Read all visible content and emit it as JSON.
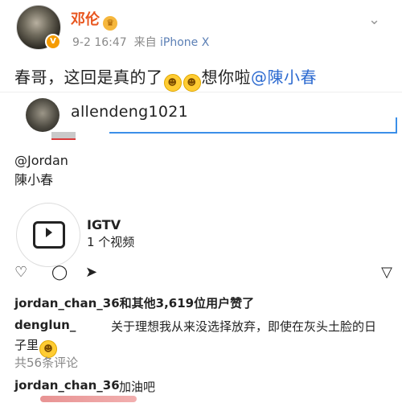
{
  "weibo": {
    "username": "邓伦",
    "date": "9-2 16:47",
    "source_prefix": "来自",
    "source_device": "iPhone X",
    "post_text_1": "春哥，这回是真的了",
    "emoji_1": "😜",
    "emoji_2": "😜",
    "post_text_2": "想你啦",
    "mention": "@陳小春"
  },
  "instagram": {
    "handle": "allendeng1021",
    "tag_line": "@Jordan",
    "tag_name": "陳小春",
    "igtv_title": "IGTV",
    "igtv_sub": "1 个视频",
    "likes_text": "jordan_chan_36和其他3,619位用户赞了",
    "caption_user": "denglun_",
    "caption_line1": "关于理想我从来没选择放弃，即使在灰头土脸的日",
    "caption_line2": "子里",
    "caption_emoji": "😜",
    "comments_count": "共56条评论",
    "comment_user": "jordan_chan_36",
    "comment_text": "加油吧"
  },
  "colors": {
    "accent_name": "#e8561f",
    "link_blue": "#2c6ad0",
    "underline_blue": "#3b8fe8"
  },
  "icons": {
    "vip_badge": "verified-v-icon",
    "crown": "crown-icon",
    "chevron": "chevron-down-icon",
    "heart": "heart-icon",
    "comment": "comment-icon",
    "share": "send-icon",
    "save": "bookmark-icon",
    "igtv": "igtv-icon"
  }
}
